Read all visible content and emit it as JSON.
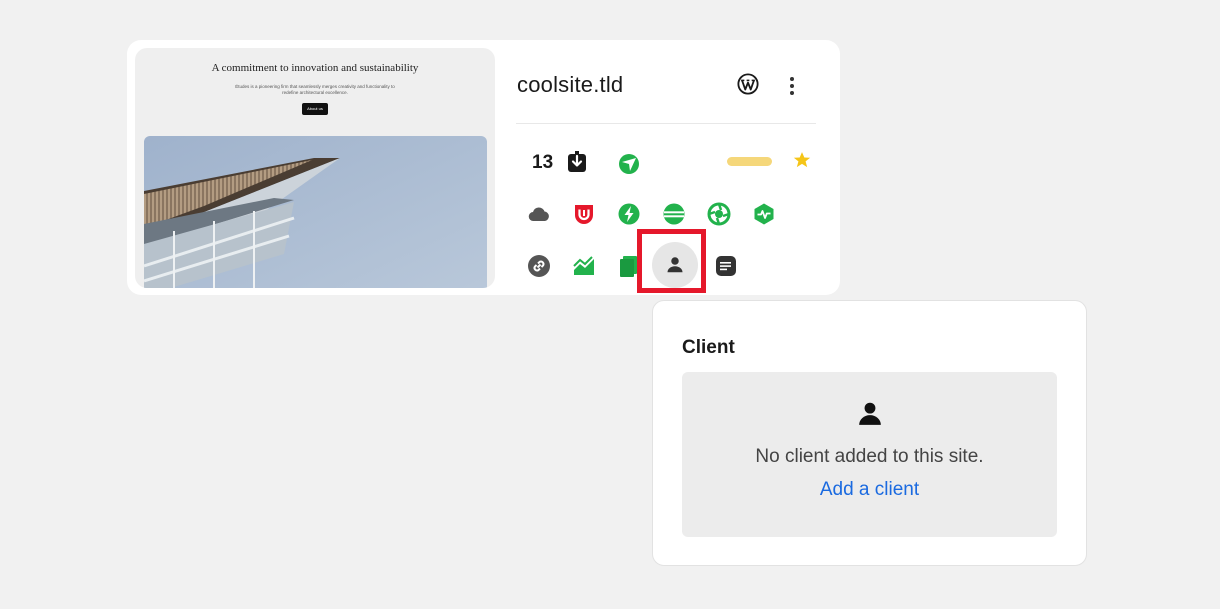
{
  "site": {
    "name": "coolsite.tld",
    "backup_count": "13",
    "colors": {
      "green": "#22b24c",
      "red": "#e5182b",
      "yellow_pill": "#f5d77a",
      "star": "#f5c518",
      "link": "#1a6ae0"
    }
  },
  "thumbnail": {
    "heading": "A commitment to innovation and sustainability",
    "text": "Études is a pioneering firm that seamlessly merges creativity and functionality to redefine architectural excellence.",
    "button": "About us"
  },
  "icons": {
    "row1": [
      "backup-download-icon",
      "speed-gauge-icon",
      "status-pill",
      "star-icon"
    ],
    "row2": [
      "cloud-icon",
      "shield-icon",
      "lightning-icon",
      "database-icon",
      "aperture-icon",
      "uptime-monitor-icon"
    ],
    "row3": [
      "link-icon",
      "analytics-chart-icon",
      "pages-icon",
      "client-icon",
      "notes-icon"
    ]
  },
  "client_popover": {
    "title": "Client",
    "empty_message": "No client added to this site.",
    "add_link": "Add a client"
  }
}
